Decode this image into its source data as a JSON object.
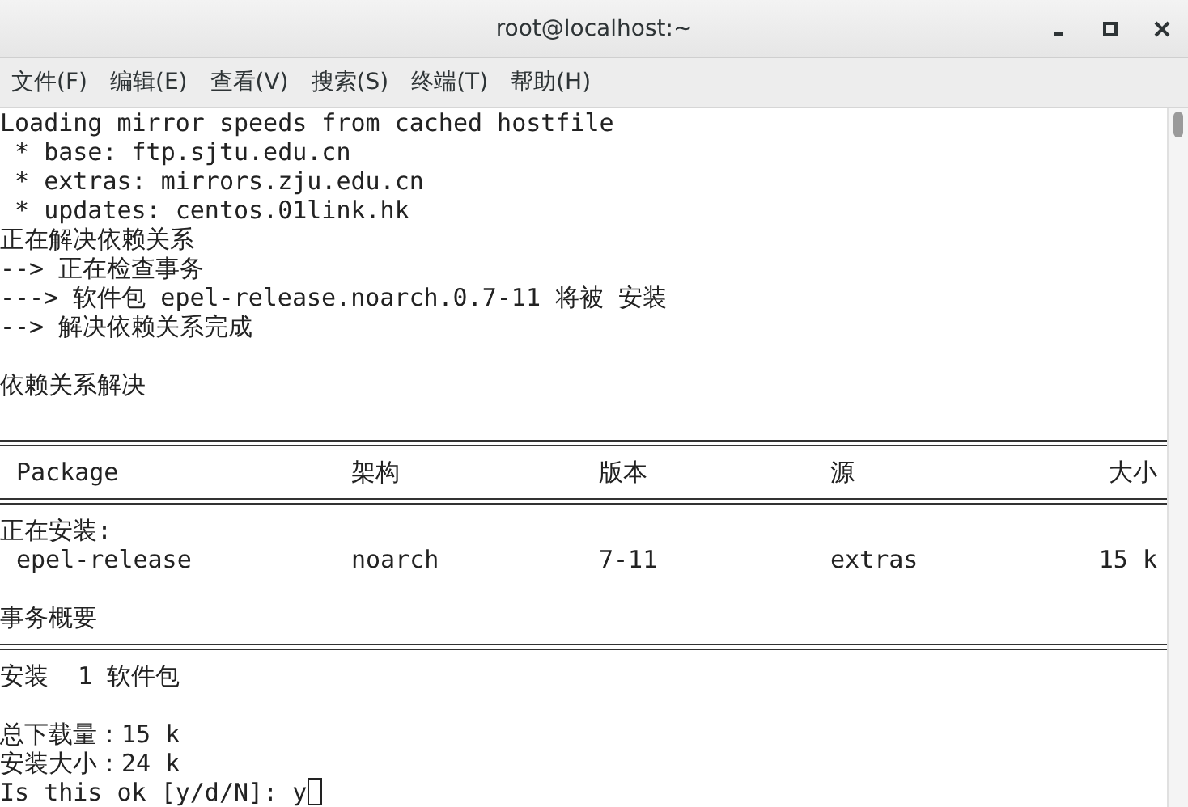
{
  "window": {
    "title": "root@localhost:~"
  },
  "menu": [
    "文件(F)",
    "编辑(E)",
    "查看(V)",
    "搜索(S)",
    "终端(T)",
    "帮助(H)"
  ],
  "terminal": [
    {
      "kind": "text",
      "text": "Loading mirror speeds from cached hostfile"
    },
    {
      "kind": "text",
      "text": " * base: ftp.sjtu.edu.cn"
    },
    {
      "kind": "text",
      "text": " * extras: mirrors.zju.edu.cn"
    },
    {
      "kind": "text",
      "text": " * updates: centos.01link.hk"
    },
    {
      "kind": "text",
      "text": "正在解决依赖关系"
    },
    {
      "kind": "text",
      "text": "--> 正在检查事务"
    },
    {
      "kind": "text",
      "text": "---> 软件包 epel-release.noarch.0.7-11 将被 安装"
    },
    {
      "kind": "text",
      "text": "--> 解决依赖关系完成"
    },
    {
      "kind": "blank"
    },
    {
      "kind": "text",
      "text": "依赖关系解决"
    },
    {
      "kind": "blank"
    },
    {
      "kind": "rule"
    },
    {
      "kind": "row",
      "cells": [
        "Package",
        "架构",
        "版本",
        "源",
        "大小"
      ]
    },
    {
      "kind": "rule"
    },
    {
      "kind": "text",
      "text": "正在安装:"
    },
    {
      "kind": "row",
      "cells": [
        "epel-release",
        "noarch",
        "7-11",
        "extras",
        "15 k"
      ]
    },
    {
      "kind": "blank"
    },
    {
      "kind": "text",
      "text": "事务概要"
    },
    {
      "kind": "rule"
    },
    {
      "kind": "text",
      "text": "安装  1 软件包"
    },
    {
      "kind": "blank"
    },
    {
      "kind": "text",
      "text": "总下载量：15 k"
    },
    {
      "kind": "text",
      "text": "安装大小：24 k"
    },
    {
      "kind": "prompt",
      "text": "Is this ok [y/d/N]: ",
      "input": "y"
    }
  ]
}
